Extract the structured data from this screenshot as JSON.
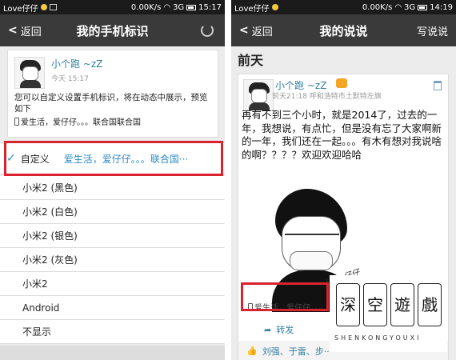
{
  "left": {
    "status": {
      "app": "Love仔仔",
      "speed": "0.00K/s",
      "network": "3G",
      "time": "15:17"
    },
    "titlebar": {
      "back_label": "返回",
      "title": "我的手机标识"
    },
    "card": {
      "nickname": "小个跑 ~zZ",
      "time": "今天 15:17",
      "description": "您可以自定义设置手机标识，将在动态中展示，预览如下",
      "signature": "爱生活，爱仔仔。。。联合国联合国"
    },
    "custom": {
      "label": "自定义",
      "value": "爱生活，爱仔仔。。。联合国···"
    },
    "options": [
      "小米2 (黑色)",
      "小米2 (白色)",
      "小米2 (银色)",
      "小米2 (灰色)",
      "小米2",
      "Android",
      "不显示"
    ]
  },
  "right": {
    "status": {
      "app": "Love仔仔",
      "speed": "0.00K/s",
      "network": "3G",
      "time": "14:19"
    },
    "titlebar": {
      "back_label": "返回",
      "title": "我的说说",
      "action": "写说说"
    },
    "section": "前天",
    "post": {
      "nickname": "小个跑 ~zZ",
      "meta": "前天21:18 呼和浩特市土默特左旗",
      "text": "再有不到三个小时，就是2014了，过去的一年，我想说，有点忙，但是没有忘了大家啊新的一年，我们还在一起。。。有木有想对我说啥的啊？？？？欢迎欢迎哈哈",
      "image_tag": "Love仔仔",
      "signature": "爱生活，爱仔仔。。。",
      "forward": "转发",
      "likes": "刘强、于雷、步···"
    }
  },
  "watermark": {
    "chars": [
      "深",
      "空",
      "遊",
      "戲"
    ],
    "sub": "SHENKONGYOUXI"
  },
  "colors": {
    "titlebar": "#3a3a3a",
    "accent_blue": "#2f88c4",
    "highlight_red": "#d9232d"
  }
}
